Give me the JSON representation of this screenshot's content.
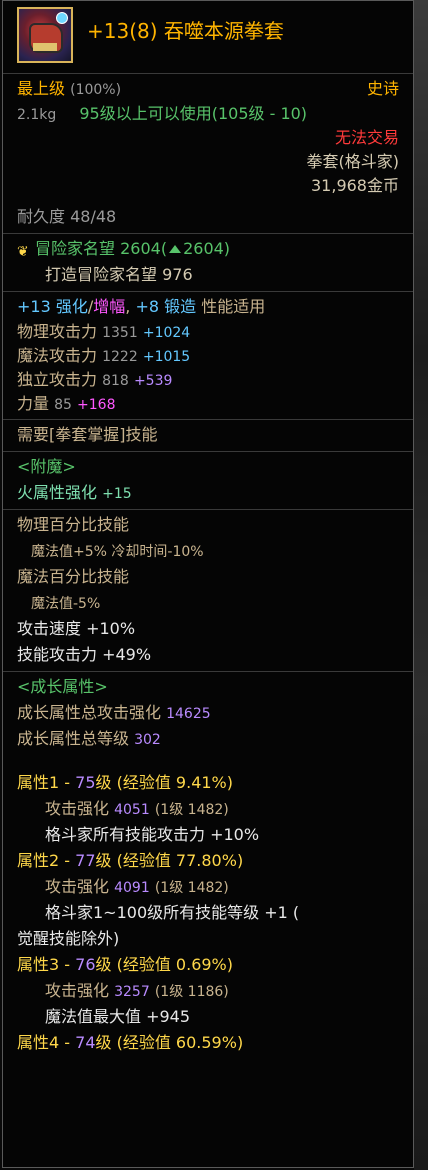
{
  "header": {
    "title": "+13(8) 吞噬本源拳套"
  },
  "basic": {
    "grade": "最上级",
    "grade_pct": "(100%)",
    "rarity": "史诗",
    "weight": "2.1kg",
    "level_req": "95级以上可以使用(105级 - 10)",
    "trade": "无法交易",
    "type": "拳套(格斗家)",
    "price": "31,968金币",
    "durability": "耐久度 48/48"
  },
  "fame": {
    "label": "冒险家名望",
    "value": "2604",
    "up": "2604",
    "paren_open": "(",
    "paren_close": ")",
    "forge_label": "打造冒险家名望",
    "forge_value": "976"
  },
  "enhance": {
    "reinforce": "+13 强化",
    "slash": "/",
    "amplify": "增幅",
    "comma": ",",
    "forge": "+8 锻造",
    "perf": "性能适用",
    "stats": [
      {
        "label": "物理攻击力",
        "base": "1351",
        "bonus": "+1024"
      },
      {
        "label": "魔法攻击力",
        "base": "1222",
        "bonus": "+1015"
      },
      {
        "label": "独立攻击力",
        "base": "818",
        "bonus": "+539"
      }
    ],
    "str_label": "力量",
    "str_base": "85",
    "str_bonus": "+168"
  },
  "skill_req": "需要[拳套掌握]技能",
  "enchant": {
    "title": "<附魔>",
    "label": "火属性强化",
    "value": "+15"
  },
  "options": {
    "phys_pct": "物理百分比技能",
    "phys_detail": "魔法值+5% 冷却时间-10%",
    "mag_pct": "魔法百分比技能",
    "mag_detail": "魔法值-5%",
    "atk_speed": "攻击速度 +10%",
    "skill_atk": "技能攻击力 +49%"
  },
  "growth": {
    "title": "<成长属性>",
    "total_atk_label": "成长属性总攻击强化",
    "total_atk": "14625",
    "total_lvl_label": "成长属性总等级",
    "total_lvl": "302",
    "attrs": [
      {
        "head": "属性1 - ",
        "lvl": "75",
        "lvl_unit": "级",
        "exp": " (经验值 9.41%)",
        "atk_label": "攻击强化",
        "atk": "4051",
        "lv1": "(1级 1482)",
        "effect": "格斗家所有技能攻击力 +10%",
        "effect2": ""
      },
      {
        "head": "属性2 - ",
        "lvl": "77",
        "lvl_unit": "级",
        "exp": " (经验值 77.80%)",
        "atk_label": "攻击强化",
        "atk": "4091",
        "lv1": "(1级 1482)",
        "effect": "格斗家1~100级所有技能等级 +1 (",
        "effect2": "觉醒技能除外)"
      },
      {
        "head": "属性3 - ",
        "lvl": "76",
        "lvl_unit": "级",
        "exp": " (经验值 0.69%)",
        "atk_label": "攻击强化",
        "atk": "3257",
        "lv1": "(1级 1186)",
        "effect": "魔法值最大值 +945",
        "effect2": ""
      },
      {
        "head": "属性4 - ",
        "lvl": "74",
        "lvl_unit": "级",
        "exp": " (经验值 60.59%)"
      }
    ]
  },
  "colors": {
    "title": "#ffb400",
    "border": "#5a5a5a",
    "green": "#58c36a",
    "red": "#ff3a3a"
  },
  "icons": {
    "item": "gauntlet-icon",
    "fame": "laurel-icon",
    "arrow": "up-triangle-icon"
  }
}
